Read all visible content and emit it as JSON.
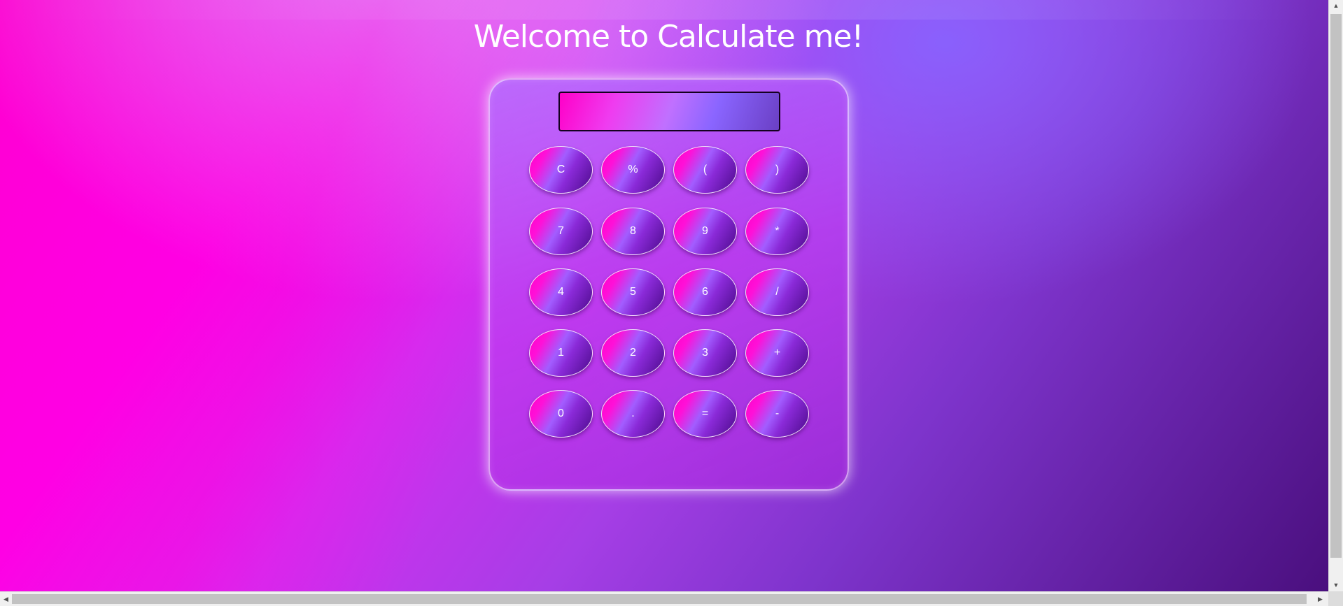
{
  "page": {
    "title": "Welcome to Calculate me!"
  },
  "display": {
    "value": ""
  },
  "buttons": [
    [
      "C",
      "%",
      "(",
      ")"
    ],
    [
      "7",
      "8",
      "9",
      "*"
    ],
    [
      "4",
      "5",
      "6",
      "/"
    ],
    [
      "1",
      "2",
      "3",
      "+"
    ],
    [
      "0",
      ".",
      "=",
      "-"
    ]
  ],
  "button_names": [
    [
      "clear-button",
      "percent-button",
      "open-paren-button",
      "close-paren-button"
    ],
    [
      "digit-7-button",
      "digit-8-button",
      "digit-9-button",
      "multiply-button"
    ],
    [
      "digit-4-button",
      "digit-5-button",
      "digit-6-button",
      "divide-button"
    ],
    [
      "digit-1-button",
      "digit-2-button",
      "digit-3-button",
      "plus-button"
    ],
    [
      "digit-0-button",
      "decimal-point-button",
      "equals-button",
      "minus-button"
    ]
  ],
  "scrollbars": {
    "up_icon": "arrow-up-icon",
    "down_icon": "arrow-down-icon",
    "left_icon": "arrow-left-icon",
    "right_icon": "arrow-right-icon"
  },
  "colors": {
    "accent_pink": "#ff00c8",
    "accent_purple": "#8a65ff",
    "text": "#ffffff"
  }
}
